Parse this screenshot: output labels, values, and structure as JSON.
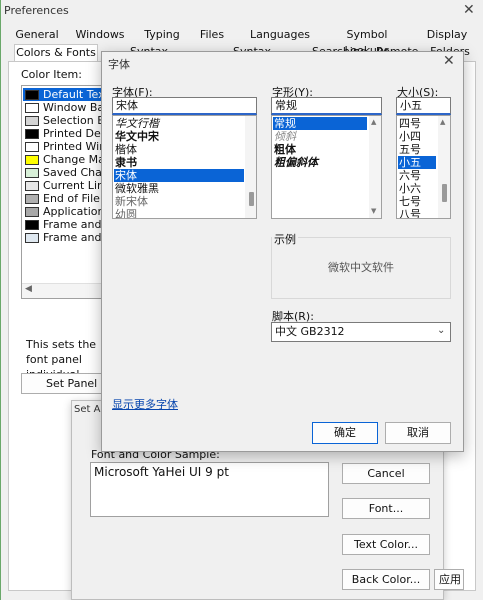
{
  "prefs": {
    "title": "Preferences",
    "tabs_row1": [
      "General",
      "Windows",
      "Typing",
      "Files",
      "Languages",
      "Symbol Lookups",
      "Display"
    ],
    "tabs_row2": [
      "Colors & Fonts",
      "Syntax Formatting",
      "Syntax Decorations",
      "Searching",
      "Remote",
      "Folders"
    ],
    "color_item_label": "Color Item:",
    "color_items": [
      {
        "label": "Default Text",
        "color": "#000000",
        "selected": true
      },
      {
        "label": "Window Background",
        "color": "#ffffff"
      },
      {
        "label": "Selection Bar",
        "color": "#d4d4d4"
      },
      {
        "label": "Printed Default",
        "color": "#000000"
      },
      {
        "label": "Printed Window",
        "color": "#ffffff"
      },
      {
        "label": "Change Marker",
        "color": "#ffff00"
      },
      {
        "label": "Saved Change",
        "color": "#d8f0d8"
      },
      {
        "label": "Current Line",
        "color": "#e8e8e8"
      },
      {
        "label": "End of File",
        "color": "#b0b0b0"
      },
      {
        "label": "Application Background",
        "color": "#a8a8a8"
      },
      {
        "label": "Frame and Panel",
        "color": "#000000"
      },
      {
        "label": "Frame and Panel",
        "color": "#dfe8f0"
      }
    ],
    "info_text": "This sets the font panel individual",
    "set_panel_button": "Set Panel Fonts..."
  },
  "set_all": {
    "title": "Set All",
    "sample_label": "Font and Color Sample:",
    "sample_text": "Microsoft YaHei UI 9 pt",
    "buttons": {
      "cancel": "Cancel",
      "font": "Font...",
      "text_color": "Text Color...",
      "back_color": "Back Color..."
    },
    "partial_button": "应用"
  },
  "font_dialog": {
    "title": "字体",
    "font_label": "字体(F):",
    "font_value": "宋体",
    "fonts": [
      "华文行楷",
      "华文中宋",
      "楷体",
      "隶书",
      "宋体",
      "微软雅黑",
      "新宋体",
      "幼圆"
    ],
    "font_selected_index": 4,
    "style_label": "字形(Y):",
    "style_value": "常规",
    "styles": [
      "常规",
      "倾斜",
      "粗体",
      "粗偏斜体"
    ],
    "style_selected_index": 0,
    "size_label": "大小(S):",
    "size_value": "小五",
    "sizes": [
      "四号",
      "小四",
      "五号",
      "小五",
      "六号",
      "小六",
      "七号",
      "八号"
    ],
    "size_selected_index": 3,
    "sample_group_label": "示例",
    "sample_preview": "微软中文软件",
    "script_label": "脚本(R):",
    "script_value": "中文 GB2312",
    "more_fonts_link": "显示更多字体",
    "ok": "确定",
    "cancel": "取消"
  },
  "colors": {
    "selection": "#0a64d6",
    "accent": "#2c65c8"
  }
}
